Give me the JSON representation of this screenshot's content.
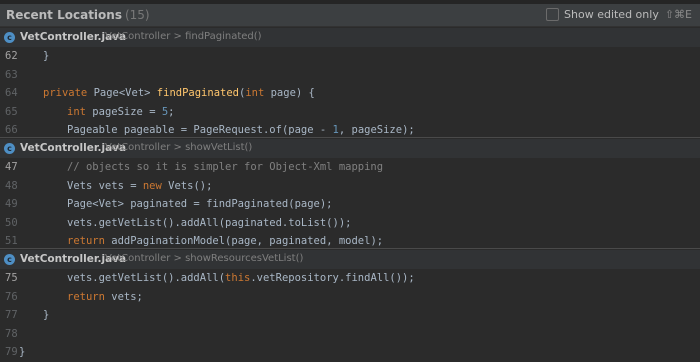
{
  "header": {
    "title": "Recent Locations",
    "count": "(15)",
    "show_edited_label": "Show edited only",
    "shortcut": "⇧⌘E"
  },
  "locations": [
    {
      "file": "VetController.java",
      "path": "VetController > findPaginated()",
      "lines": [
        {
          "num": "62",
          "parts": [
            [
              "p",
              "}"
            ]
          ],
          "indent": 0
        },
        {
          "num": "63",
          "parts": [],
          "indent": 0
        },
        {
          "num": "64",
          "parts": [
            [
              "kw",
              "private "
            ],
            [
              "p",
              "Page<Vet> "
            ],
            [
              "fn",
              "findPaginated"
            ],
            [
              "p",
              "("
            ],
            [
              "kw",
              "int "
            ],
            [
              "p",
              "page) {"
            ]
          ],
          "indent": 0
        },
        {
          "num": "65",
          "parts": [
            [
              "kw",
              "int "
            ],
            [
              "p",
              "pageSize = "
            ],
            [
              "num",
              "5"
            ],
            [
              "p",
              ";"
            ]
          ],
          "indent": 1
        },
        {
          "num": "66",
          "parts": [
            [
              "p",
              "Pageable pageable = PageRequest."
            ],
            [
              "p",
              "of"
            ],
            [
              "p",
              "(page - "
            ],
            [
              "num",
              "1"
            ],
            [
              "p",
              ", pageSize);"
            ]
          ],
          "indent": 1
        }
      ],
      "current_line": "62"
    },
    {
      "file": "VetController.java",
      "path": "VetController > showVetList()",
      "lines": [
        {
          "num": "47",
          "parts": [
            [
              "cm",
              "// objects so it is simpler for Object-Xml mapping"
            ]
          ],
          "indent": 1
        },
        {
          "num": "48",
          "parts": [
            [
              "p",
              "Vets vets = "
            ],
            [
              "kw",
              "new "
            ],
            [
              "p",
              "Vets();"
            ]
          ],
          "indent": 1
        },
        {
          "num": "49",
          "parts": [
            [
              "p",
              "Page<Vet> paginated = findPaginated(page);"
            ]
          ],
          "indent": 1
        },
        {
          "num": "50",
          "parts": [
            [
              "p",
              "vets.getVetList().addAll(paginated.toList());"
            ]
          ],
          "indent": 1
        },
        {
          "num": "51",
          "parts": [
            [
              "kw",
              "return "
            ],
            [
              "p",
              "addPaginationModel(page, paginated, model);"
            ]
          ],
          "indent": 1
        }
      ],
      "current_line": "47"
    },
    {
      "file": "VetController.java",
      "path": "VetController > showResourcesVetList()",
      "lines": [
        {
          "num": "75",
          "parts": [
            [
              "p",
              "vets.getVetList().addAll("
            ],
            [
              "kw",
              "this"
            ],
            [
              "p",
              ".vetRepository.findAll());"
            ]
          ],
          "indent": 1
        },
        {
          "num": "76",
          "parts": [
            [
              "kw",
              "return "
            ],
            [
              "p",
              "vets;"
            ]
          ],
          "indent": 1
        },
        {
          "num": "77",
          "parts": [
            [
              "p",
              "}"
            ]
          ],
          "indent": 0,
          "extra_indent": true
        },
        {
          "num": "78",
          "parts": [],
          "indent": 0
        },
        {
          "num": "79",
          "parts": [
            [
              "p",
              "}"
            ]
          ],
          "indent": -1
        }
      ],
      "current_line": "75"
    }
  ]
}
